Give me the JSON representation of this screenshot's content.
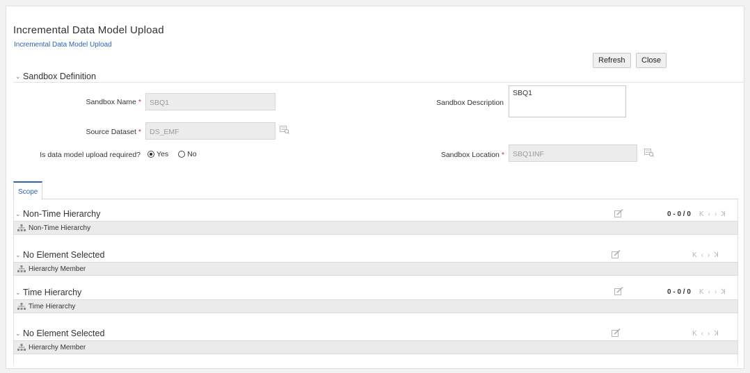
{
  "header": {
    "title": "Incremental Data Model Upload",
    "breadcrumb": "Incremental Data Model Upload"
  },
  "toolbar": {
    "refresh_label": "Refresh",
    "close_label": "Close"
  },
  "sandbox": {
    "section_title": "Sandbox Definition",
    "name_label": "Sandbox Name",
    "name_value": "SBQ1",
    "description_label": "Sandbox Description",
    "description_value": "SBQ1",
    "dataset_label": "Source Dataset",
    "dataset_value": "DS_EMF",
    "upload_label": "Is data model upload required?",
    "upload_options": [
      "Yes",
      "No"
    ],
    "upload_selected": "Yes",
    "location_label": "Sandbox Location",
    "location_value": "SBQ1INF",
    "required_marker": "*"
  },
  "tabs": {
    "scope_label": "Scope"
  },
  "hierarchies": [
    {
      "title": "Non-Time Hierarchy",
      "row_label": "Non-Time Hierarchy",
      "count": "0 - 0 / 0"
    },
    {
      "title": "No Element Selected",
      "row_label": "Hierarchy Member",
      "count": ""
    },
    {
      "title": "Time Hierarchy",
      "row_label": "Time Hierarchy",
      "count": "0 - 0 / 0"
    },
    {
      "title": "No Element Selected",
      "row_label": "Hierarchy Member",
      "count": ""
    }
  ],
  "pager_glyphs": {
    "first": "K",
    "prev": "‹",
    "next": "›",
    "last": "ꓘ"
  },
  "colors": {
    "accent": "#2a62b3",
    "required": "#cc2b2b"
  }
}
